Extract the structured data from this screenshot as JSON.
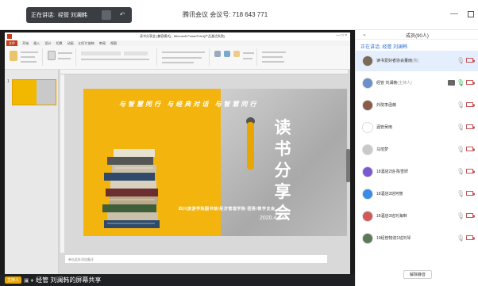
{
  "topbar": {
    "speaking_label": "正在讲话:",
    "speaking_name": "经管 刘澜韩",
    "meeting_title": "腾讯会议 会议号: 718 643 771",
    "minimize": "—"
  },
  "ppt": {
    "window_title": "读书分享会 [兼容模式] - Microsoft PowerPoint(产品激活失败)",
    "window_controls": "—  □  ×",
    "tabs": [
      "文件",
      "开始",
      "插入",
      "设计",
      "切换",
      "动画",
      "幻灯片放映",
      "审阅",
      "视图"
    ],
    "thumb_number": "1",
    "notes_placeholder": "单击此处添加备注",
    "status_left": "幻灯片第 1 张，共 1 张   \"Office 主题\"   中文(中国)",
    "status_right": "73%"
  },
  "slide": {
    "slogan": "与智慧同行 与经典对话 与智慧同行",
    "title_chars": [
      "读",
      "书",
      "分",
      "享",
      "会"
    ],
    "organizer": "四川旅游学院图书馆/经济管理学院·团委/教学支会",
    "date": "2020.4.24"
  },
  "sharebar": {
    "host_badge": "主持人",
    "icons": "▣ ♦",
    "text": "经管 刘澜韩的屏幕共享"
  },
  "panel": {
    "collapse_icon": "⌄",
    "title": "成员(90人)",
    "speaking": "正在讲话: 经管 刘澜韩",
    "members": [
      {
        "name": "读书爱好者协会董雨",
        "role": "(我)",
        "color": "#7a6a5a",
        "selected": true,
        "mic_on": false,
        "share": false
      },
      {
        "name": "经管 刘澜韩",
        "role": "(主持人)",
        "color": "#6a8fc9",
        "selected": false,
        "mic_on": true,
        "share": true
      },
      {
        "name": "外院李函薇",
        "role": "",
        "color": "#8a5a4a",
        "selected": false,
        "mic_on": false,
        "share": false
      },
      {
        "name": "酒管吴雨",
        "role": "",
        "color": "#ffffff",
        "selected": false,
        "mic_on": false,
        "share": false
      },
      {
        "name": "马瑄梦",
        "role": "",
        "color": "#c9c9c9",
        "selected": false,
        "mic_on": false,
        "share": false
      },
      {
        "name": "18酒店2班-陈雪妍",
        "role": "",
        "color": "#7a5ad0",
        "selected": false,
        "mic_on": false,
        "share": false
      },
      {
        "name": "18酒店3班何丽",
        "role": "",
        "color": "#3a8ae8",
        "selected": false,
        "mic_on": false,
        "share": false
      },
      {
        "name": "18酒店3班刘海琳",
        "role": "",
        "color": "#d05a5a",
        "selected": false,
        "mic_on": false,
        "share": false
      },
      {
        "name": "19经管物流1班刘琴",
        "role": "",
        "color": "#5a7a5a",
        "selected": false,
        "mic_on": false,
        "share": false
      }
    ],
    "mute_all": "解除静音"
  }
}
